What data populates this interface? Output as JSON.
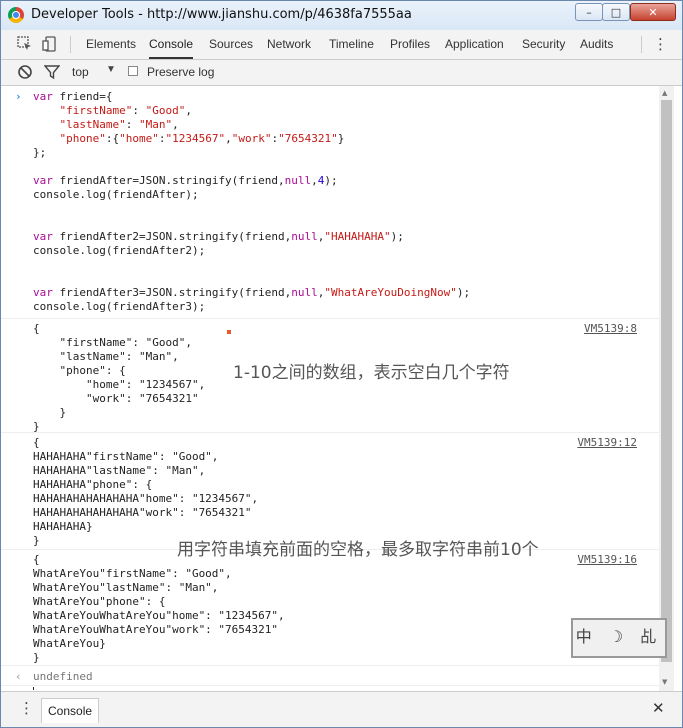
{
  "window": {
    "title": "Developer Tools - http://www.jianshu.com/p/4638fa7555aa",
    "min_label": "0",
    "max_label": "1",
    "close_label": "r"
  },
  "tabs": [
    "Elements",
    "Console",
    "Sources",
    "Network",
    "Timeline",
    "Profiles",
    "Application",
    "Security",
    "Audits"
  ],
  "filter": {
    "context": "top",
    "preserve_log": "Preserve log"
  },
  "input_code": [
    "var friend={",
    "    \"firstName\": \"Good\",",
    "    \"lastName\": \"Man\",",
    "    \"phone\":{\"home\":\"1234567\",\"work\":\"7654321\"}",
    "};",
    "",
    "var friendAfter=JSON.stringify(friend,null,4);",
    "console.log(friendAfter);",
    "",
    "",
    "var friendAfter2=JSON.stringify(friend,null,\"HAHAHAHA\");",
    "console.log(friendAfter2);",
    "",
    "",
    "var friendAfter3=JSON.stringify(friend,null,\"WhatAreYouDoingNow\");",
    "console.log(friendAfter3);"
  ],
  "outputs": [
    {
      "source": "VM5139:8",
      "lines": [
        "{",
        "    \"firstName\": \"Good\",",
        "    \"lastName\": \"Man\",",
        "    \"phone\": {",
        "        \"home\": \"1234567\",",
        "        \"work\": \"7654321\"",
        "    }",
        "}"
      ]
    },
    {
      "source": "VM5139:12",
      "lines": [
        "{",
        "HAHAHAHA\"firstName\": \"Good\",",
        "HAHAHAHA\"lastName\": \"Man\",",
        "HAHAHAHA\"phone\": {",
        "HAHAHAHAHAHAHAHA\"home\": \"1234567\",",
        "HAHAHAHAHAHAHAHA\"work\": \"7654321\"",
        "HAHAHAHA}",
        "}"
      ]
    },
    {
      "source": "VM5139:16",
      "lines": [
        "{",
        "WhatAreYou\"firstName\": \"Good\",",
        "WhatAreYou\"lastName\": \"Man\",",
        "WhatAreYou\"phone\": {",
        "WhatAreYouWhatAreYou\"home\": \"1234567\",",
        "WhatAreYouWhatAreYou\"work\": \"7654321\"",
        "WhatAreYou}",
        "}"
      ]
    }
  ],
  "result": "undefined",
  "annotations": {
    "a1": "1-10之间的数组，表示空白几个字符",
    "a2": "用字符串填充前面的空格，最多取字符串前10个"
  },
  "stamp": "中 ☽ 乩",
  "drawer": {
    "tab": "Console"
  }
}
